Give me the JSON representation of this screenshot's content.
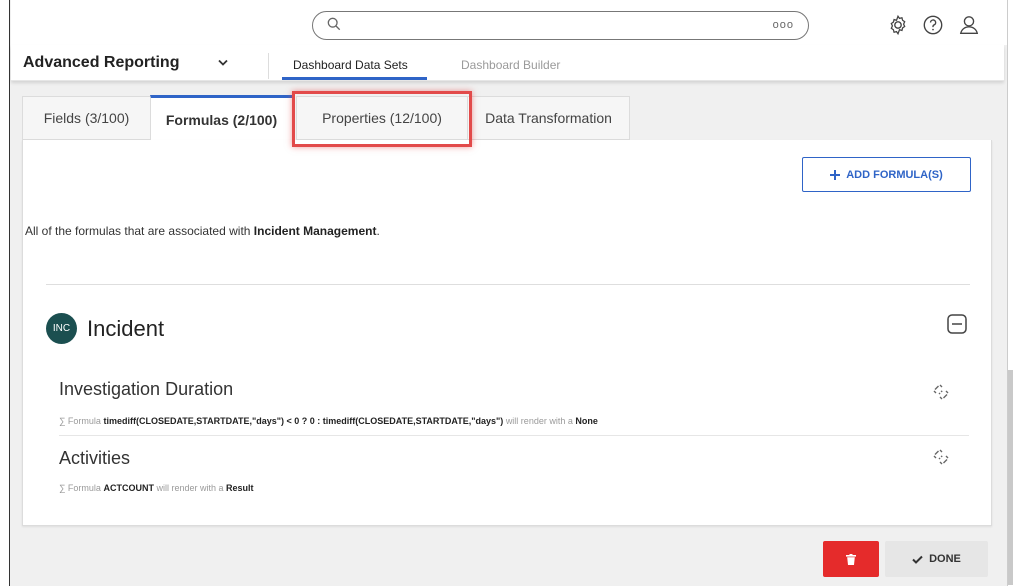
{
  "topbar": {
    "search_placeholder": "",
    "more_label": "ooo"
  },
  "navbar": {
    "app_title": "Advanced Reporting",
    "tabs": [
      "Dashboard Data Sets",
      "Dashboard Builder"
    ],
    "active_tab": "Dashboard Data Sets"
  },
  "tabs": [
    {
      "label": "Fields (3/100)",
      "active": false
    },
    {
      "label": "Formulas (2/100)",
      "active": true
    },
    {
      "label": "Properties (12/100)",
      "active": false
    },
    {
      "label": "Data Transformation",
      "active": false
    }
  ],
  "panel": {
    "add_button": "ADD FORMULA(S)",
    "description_prefix": "All of the formulas that are associated with ",
    "description_entity": "Incident Management",
    "description_suffix": ".",
    "group": {
      "badge": "INC",
      "title": "Incident"
    },
    "formulas": [
      {
        "title": "Investigation Duration",
        "formula_label": "Formula",
        "expression": "timediff(CLOSEDATE,STARTDATE,\"days\") < 0 ? 0 : timediff(CLOSEDATE,STARTDATE,\"days\")",
        "render_text": "will render with a",
        "render_type": "None"
      },
      {
        "title": "Activities",
        "formula_label": "Formula",
        "expression": "ACTCOUNT",
        "render_text": "will render with a",
        "render_type": "Result"
      }
    ]
  },
  "footer": {
    "done_label": "DONE"
  },
  "colors": {
    "accent": "#2f64c7",
    "danger": "#e52b2b",
    "badge": "#1b4f50",
    "highlight": "#e24a4a"
  },
  "icons": [
    "search-icon",
    "settings-gear-icon",
    "help-icon",
    "user-icon",
    "chevron-down-icon",
    "plus-icon",
    "collapse-minus-icon",
    "unlink-icon",
    "trash-icon",
    "checkmark-icon"
  ]
}
